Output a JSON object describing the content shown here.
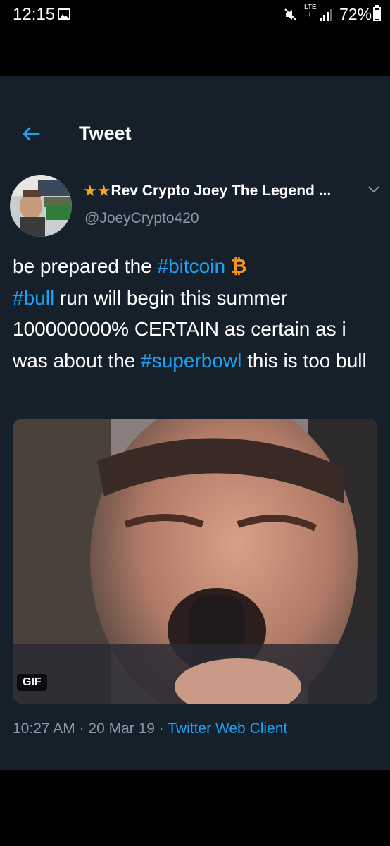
{
  "status_bar": {
    "time": "12:15",
    "network": "LTE",
    "battery": "72%",
    "battery_level": 0.72
  },
  "header": {
    "title": "Tweet"
  },
  "tweet": {
    "stars": "★★",
    "display_name": "Rev Crypto Joey The Legend ...",
    "handle": "@JoeyCrypto420",
    "text_parts": {
      "p1": "be prepared the ",
      "tag1": "#bitcoin",
      "btc_symbol": "₿",
      "tag2": "#bull",
      "p2": " run will begin this summer 100000000% CERTAIN as certain as i was about the ",
      "tag3": "#superbowl",
      "p3": " this is too bull"
    },
    "media_badge": "GIF",
    "time": "10:27 AM",
    "date": "20 Mar 19",
    "sep": " · ",
    "client": "Twitter Web Client"
  },
  "colors": {
    "background": "#15202b",
    "accent": "#1da1f2",
    "secondary_text": "#8899a6",
    "star": "#f5a623"
  }
}
